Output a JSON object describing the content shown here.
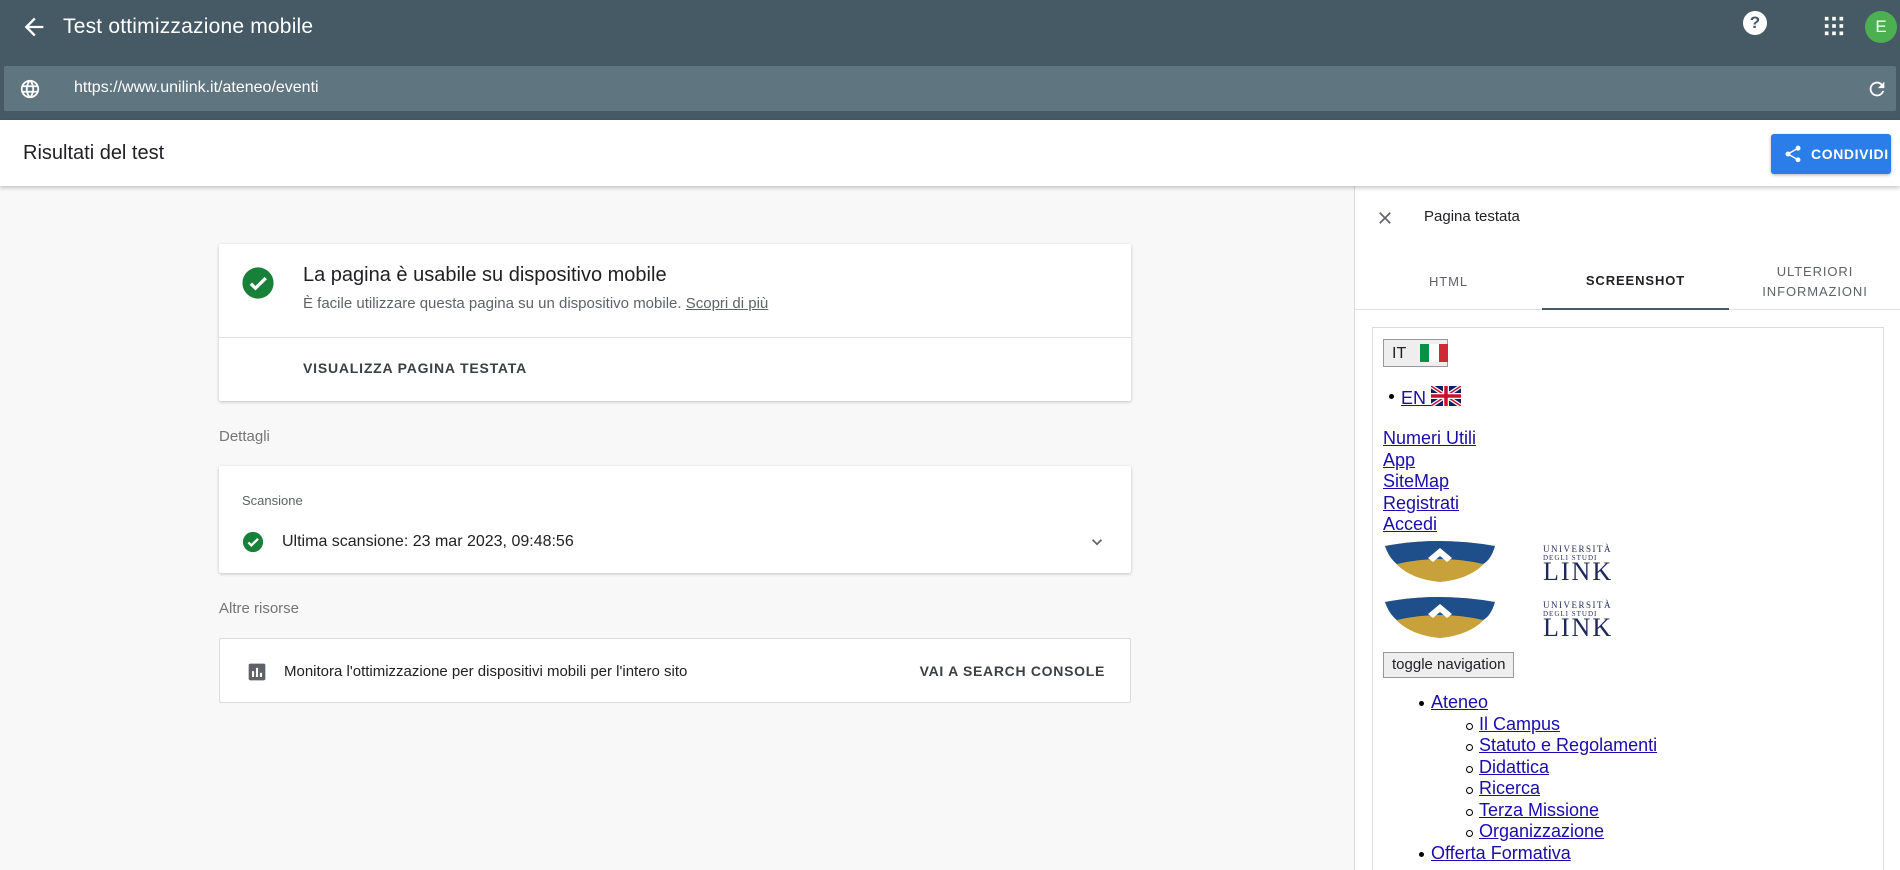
{
  "topbar": {
    "title": "Test ottimizzazione mobile",
    "back_icon": "arrow-back-icon",
    "help_label": "?",
    "avatar_letter": "E"
  },
  "urlbar": {
    "url": "https://www.unilink.it/ateneo/eventi"
  },
  "results": {
    "title": "Risultati del test",
    "share_label": "CONDIVIDI"
  },
  "main": {
    "headline": "La pagina è usabile su dispositivo mobile",
    "subtext": "È facile utilizzare questa pagina su un dispositivo mobile.",
    "learn_more": "Scopri di più",
    "view_tested": "VISUALIZZA PAGINA TESTATA",
    "details_label": "Dettagli",
    "scan_label": "Scansione",
    "scan_value": "Ultima scansione: 23 mar 2023, 09:48:56",
    "other_label": "Altre risorse",
    "resource_text": "Monitora l'ottimizzazione per dispositivi mobili per l'intero sito",
    "resource_link": "VAI A SEARCH CONSOLE"
  },
  "panel": {
    "title": "Pagina testata",
    "tabs": [
      {
        "label": "HTML"
      },
      {
        "label": "SCREENSHOT"
      },
      {
        "label": "ULTERIORI INFORMAZIONI"
      }
    ],
    "screenshot": {
      "lang_it": "IT",
      "lang_en": "EN",
      "links": [
        "Numeri Utili",
        "App",
        "SiteMap",
        "Registrati",
        "Accedi"
      ],
      "logo_text_top": "UNIVERSITÀ DEGLI STUDI",
      "logo_text_main": "LINK",
      "toggle": "toggle navigation",
      "nav": {
        "ateneo": "Ateneo",
        "sub": [
          "Il Campus",
          "Statuto e Regolamenti",
          "Didattica",
          "Ricerca",
          "Terza Missione",
          "Organizzazione"
        ],
        "offerta": "Offerta Formativa"
      }
    }
  },
  "colors": {
    "topbar": "#455a64",
    "accent": "#2b7de9",
    "success": "#188038"
  }
}
